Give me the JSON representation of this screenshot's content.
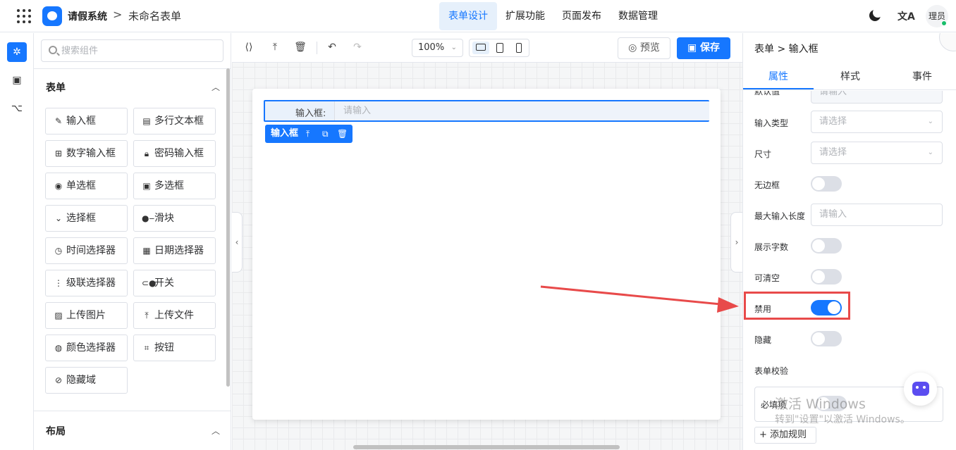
{
  "header": {
    "app_name": "请假系统",
    "separator": ">",
    "form_name": "未命名表单",
    "nav": [
      "表单设计",
      "扩展功能",
      "页面发布",
      "数据管理"
    ],
    "active_nav": "表单设计",
    "translate_glyph": "文A",
    "user_label": "理员"
  },
  "components_panel": {
    "search_placeholder": "搜索组件",
    "form_section_title": "表单",
    "form_items": [
      {
        "label": "输入框",
        "icon": "pencil-icon"
      },
      {
        "label": "多行文本框",
        "icon": "textarea-icon"
      },
      {
        "label": "数字输入框",
        "icon": "number-icon"
      },
      {
        "label": "密码输入框",
        "icon": "lock-icon"
      },
      {
        "label": "单选框",
        "icon": "radio-icon"
      },
      {
        "label": "多选框",
        "icon": "checkbox-icon"
      },
      {
        "label": "选择框",
        "icon": "select-icon"
      },
      {
        "label": "滑块",
        "icon": "slider-icon"
      },
      {
        "label": "时间选择器",
        "icon": "clock-icon"
      },
      {
        "label": "日期选择器",
        "icon": "calendar-icon"
      },
      {
        "label": "级联选择器",
        "icon": "cascader-icon"
      },
      {
        "label": "开关",
        "icon": "switch-icon"
      },
      {
        "label": "上传图片",
        "icon": "image-icon"
      },
      {
        "label": "上传文件",
        "icon": "upload-icon"
      },
      {
        "label": "颜色选择器",
        "icon": "palette-icon"
      },
      {
        "label": "按钮",
        "icon": "button-icon"
      },
      {
        "label": "隐藏域",
        "icon": "eye-off-icon"
      }
    ],
    "layout_section_title": "布局"
  },
  "toolbar": {
    "zoom": "100%",
    "preview_label": "预览",
    "save_label": "保存"
  },
  "canvas": {
    "field_label": "输入框:",
    "field_placeholder": "请输入",
    "selection_tag": "输入框"
  },
  "properties": {
    "breadcrumb": "表单 > 输入框",
    "tabs": [
      "属性",
      "样式",
      "事件"
    ],
    "active_tab": "属性",
    "rows": {
      "default_value": {
        "label": "默认值",
        "placeholder": "请输入"
      },
      "input_type": {
        "label": "输入类型",
        "placeholder": "请选择"
      },
      "size": {
        "label": "尺寸",
        "placeholder": "请选择"
      },
      "no_border": {
        "label": "无边框",
        "value": false
      },
      "max_length": {
        "label": "最大输入长度",
        "placeholder": "请输入"
      },
      "show_count": {
        "label": "展示字数",
        "value": false
      },
      "clearable": {
        "label": "可清空",
        "value": false
      },
      "disabled": {
        "label": "禁用",
        "value": true
      },
      "hidden": {
        "label": "隐藏",
        "value": false
      }
    },
    "validation_title": "表单校验",
    "required_label": "必填项",
    "add_rule_label": "+ 添加规则"
  },
  "watermark": {
    "line1": "激活 Windows",
    "line2": "转到\"设置\"以激活 Windows。"
  },
  "colors": {
    "primary": "#1677ff",
    "highlight": "#e84a4a"
  }
}
